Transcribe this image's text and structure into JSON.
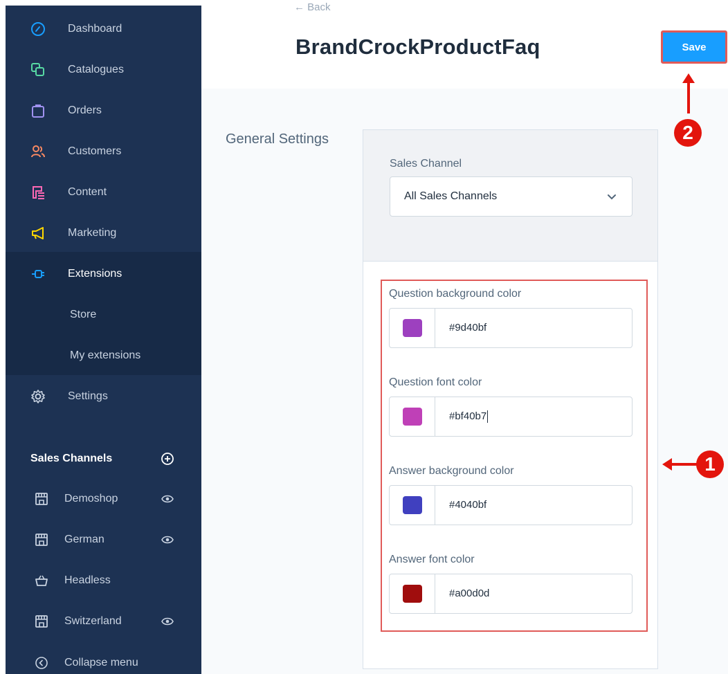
{
  "sidebar": {
    "items": [
      {
        "label": "Dashboard",
        "icon": "dashboard-gauge-icon"
      },
      {
        "label": "Catalogues",
        "icon": "catalogues-icon"
      },
      {
        "label": "Orders",
        "icon": "shopping-bag-icon"
      },
      {
        "label": "Customers",
        "icon": "users-icon"
      },
      {
        "label": "Content",
        "icon": "content-icon"
      },
      {
        "label": "Marketing",
        "icon": "megaphone-icon"
      },
      {
        "label": "Extensions",
        "icon": "plug-icon"
      }
    ],
    "sub_items": [
      {
        "label": "Store"
      },
      {
        "label": "My extensions"
      }
    ],
    "settings": {
      "label": "Settings",
      "icon": "gear-icon"
    },
    "sales_channels": {
      "heading": "Sales Channels",
      "items": [
        {
          "label": "Demoshop",
          "icon": "storefront-icon",
          "eye": true
        },
        {
          "label": "German",
          "icon": "storefront-icon",
          "eye": true
        },
        {
          "label": "Headless",
          "icon": "basket-icon",
          "eye": false
        },
        {
          "label": "Switzerland",
          "icon": "storefront-icon",
          "eye": true
        }
      ]
    },
    "collapse_label": "Collapse menu",
    "colors": {
      "bg": "#1d3253",
      "active_bg": "#172a47",
      "text": "#c9d3e1"
    }
  },
  "header": {
    "back_label": "Back",
    "title": "BrandCrockProductFaq",
    "save_label": "Save"
  },
  "content": {
    "section_label": "General Settings",
    "sales_channel_label": "Sales Channel",
    "sales_channel_value": "All Sales Channels",
    "fields": [
      {
        "label": "Question background color",
        "value": "#9d40bf",
        "swatch": "#9d40bf"
      },
      {
        "label": "Question font color",
        "value": "#bf40b7",
        "swatch": "#bf40b7"
      },
      {
        "label": "Answer background color",
        "value": "#4040bf",
        "swatch": "#4040bf"
      },
      {
        "label": "Answer font color",
        "value": "#a00d0d",
        "swatch": "#a00d0d"
      }
    ]
  },
  "annotations": {
    "badge_1": "1",
    "badge_2": "2",
    "color": "#e3150d"
  }
}
